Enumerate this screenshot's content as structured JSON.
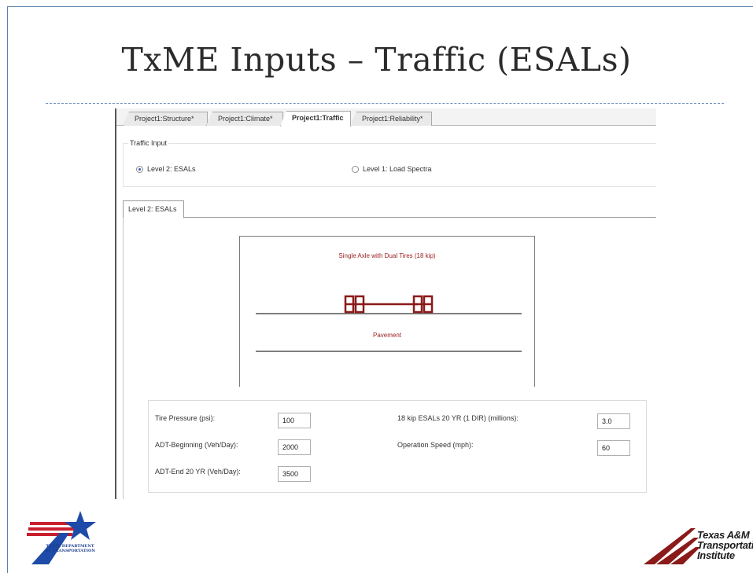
{
  "slide": {
    "title": "TxME Inputs – Traffic (ESALs)"
  },
  "tabs": [
    {
      "label": "Project1:Structure*",
      "active": false
    },
    {
      "label": "Project1:Climate*",
      "active": false
    },
    {
      "label": "Project1:Traffic",
      "active": true
    },
    {
      "label": "Project1:Reliability*",
      "active": false
    }
  ],
  "traffic_input": {
    "group_label": "Traffic Input",
    "options": [
      {
        "label": "Level 2: ESALs",
        "selected": true
      },
      {
        "label": "Level 1: Load Spectra",
        "selected": false
      }
    ]
  },
  "subtab": {
    "label": "Level 2: ESALs"
  },
  "diagram": {
    "caption": "Single Axle with Dual Tires (18 kip)",
    "pavement_label": "Pavement",
    "axle_color": "#8b1a1a"
  },
  "fields": {
    "tire_pressure": {
      "label": "Tire Pressure (psi):",
      "value": "100"
    },
    "adt_beginning": {
      "label": "ADT-Beginning (Veh/Day):",
      "value": "2000"
    },
    "adt_end": {
      "label": "ADT-End 20 YR (Veh/Day):",
      "value": "3500"
    },
    "esals": {
      "label": "18 kip ESALs 20 YR (1 DIR) (millions):",
      "value": "3.0"
    },
    "operation_speed": {
      "label": "Operation Speed (mph):",
      "value": "60"
    }
  },
  "logos": {
    "txdot": {
      "icon": "txdot-star-logo",
      "text": "TEXAS DEPARTMENT OF TRANSPORTATION"
    },
    "tti": {
      "icon": "tti-road-logo",
      "lines": [
        "Texas A&M",
        "Transportation",
        "Institute"
      ]
    }
  }
}
